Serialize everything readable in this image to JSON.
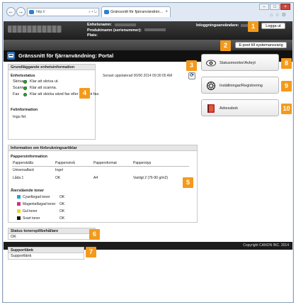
{
  "browser": {
    "url": "http://",
    "tab_title": "Gränssnitt för fjärranvändnin...",
    "back_glyph": "←",
    "forward_glyph": "→",
    "close_glyph": "×",
    "min_glyph": "–",
    "max_glyph": "□",
    "toolbar_glyphs": "⌂☆⚙"
  },
  "header": {
    "device_name_label": "Enhetsnamn:",
    "product_name_label": "Produktnamn (serienummer):",
    "location_label": "Plats:",
    "login_mode_label": "Inloggningsanvändare:",
    "logout_label": "Logga ut",
    "email_admin_label": "E-post till systemansvarig"
  },
  "portal": {
    "title": "Gränssnitt för fjärranvändning: Portal",
    "updated_text": "Senast uppdaterad 00/00 2014 09:30:05 AM"
  },
  "basic_info": {
    "title": "Grundläggande enhetsinformation",
    "device_status_heading": "Enhetsstatus",
    "status": [
      {
        "name": "Skrivare",
        "value": "Klar att skriva ut."
      },
      {
        "name": "Scanner",
        "value": "Klar att scanna."
      },
      {
        "name": "Fax",
        "value": "Klar att skicka sänd fax eller ta emot fax."
      }
    ],
    "error_heading": "Felinformation",
    "error_text": "Ingu fel."
  },
  "consumables": {
    "title": "Information om förbrukningsartiklar",
    "paper_heading": "Pappersinformation",
    "paper_columns": [
      "Papperskälla",
      "Pappersnivå",
      "Pappersformat",
      "Papperstyp"
    ],
    "paper_rows": [
      [
        "Universalfack",
        "Ingel",
        "",
        ""
      ],
      [
        "Låda 1",
        "OK",
        "A4",
        "Vanligt 2 (76-90 g/m2)"
      ]
    ],
    "toner_heading": "Återstående toner",
    "toner": [
      {
        "name": "Cyanfärgad toner",
        "status": "OK",
        "color": "#1fa3d6"
      },
      {
        "name": "Magentafärgad toner",
        "status": "OK",
        "color": "#d42a8c"
      },
      {
        "name": "Gul toner",
        "status": "OK",
        "color": "#f5d515"
      },
      {
        "name": "Svart toner",
        "status": "OK",
        "color": "#111111"
      }
    ]
  },
  "waste_toner": {
    "title": "Status tonerspillbehållare",
    "value": "OK"
  },
  "support": {
    "title": "Supportlänk",
    "value": "Supportlänk"
  },
  "side_buttons": {
    "status_monitor": "Statusmonitor/Avbryt",
    "settings": "Inställningar/Registrering",
    "address_book": "Adressbok"
  },
  "callouts": [
    "1",
    "2",
    "3",
    "4",
    "5",
    "6",
    "7",
    "8",
    "9",
    "10"
  ],
  "footer": {
    "copyright": "Copyright CANON INC. 2014"
  },
  "colors": {
    "callout": "#f39a1c",
    "header_bg": "#1e1e1e",
    "status_ok": "#2ca23a"
  }
}
